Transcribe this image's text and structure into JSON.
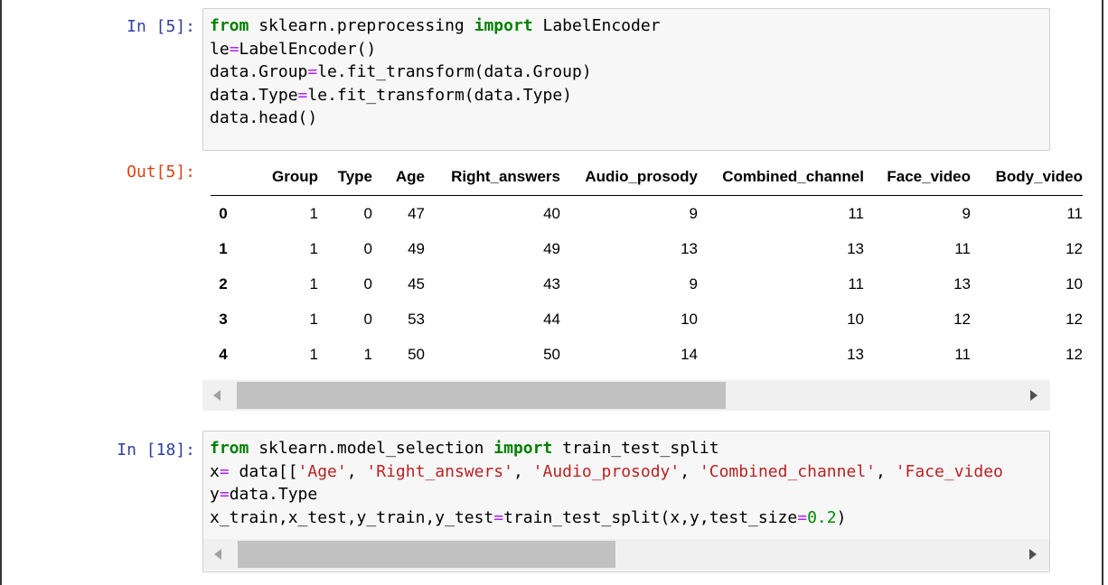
{
  "cells": {
    "cell5": {
      "in_prompt": "In [5]:",
      "out_prompt": "Out[5]:",
      "code": {
        "l1_from": "from",
        "l1_mod": " sklearn.preprocessing ",
        "l1_import": "import",
        "l1_name": " LabelEncoder",
        "l2_a": "le",
        "l2_eq": "=",
        "l2_b": "LabelEncoder()",
        "l3_a": "data.Group",
        "l3_eq": "=",
        "l3_b": "le.fit_transform(data.Group)",
        "l4_a": "data.Type",
        "l4_eq": "=",
        "l4_b": "le.fit_transform(data.Type)",
        "l5": "data.head()"
      }
    },
    "cell18": {
      "in_prompt": "In [18]:",
      "code": {
        "l1_from": "from",
        "l1_mod": " sklearn.model_selection ",
        "l1_import": "import",
        "l1_name": " train_test_split",
        "l2_a": "x",
        "l2_eq": "=",
        "l2_b": " data[[",
        "l2_s1": "'Age'",
        "l2_c1": ", ",
        "l2_s2": "'Right_answers'",
        "l2_c2": ", ",
        "l2_s3": "'Audio_prosody'",
        "l2_c3": ", ",
        "l2_s4": "'Combined_channel'",
        "l2_c4": ", ",
        "l2_s5": "'Face_video",
        "l3_a": "y",
        "l3_eq": "=",
        "l3_b": "data.Type",
        "l4_a": "x_train,x_test,y_train,y_test",
        "l4_eq": "=",
        "l4_b": "train_test_split(x,y,test_size",
        "l4_eq2": "=",
        "l4_num": "0.2",
        "l4_end": ")"
      }
    }
  },
  "dataframe": {
    "columns": [
      "Group",
      "Type",
      "Age",
      "Right_answers",
      "Audio_prosody",
      "Combined_channel",
      "Face_video",
      "Body_video"
    ],
    "rows": [
      {
        "index": "0",
        "values": [
          "1",
          "0",
          "47",
          "40",
          "9",
          "11",
          "9",
          "11"
        ]
      },
      {
        "index": "1",
        "values": [
          "1",
          "0",
          "49",
          "49",
          "13",
          "13",
          "11",
          "12"
        ]
      },
      {
        "index": "2",
        "values": [
          "1",
          "0",
          "45",
          "43",
          "9",
          "11",
          "13",
          "10"
        ]
      },
      {
        "index": "3",
        "values": [
          "1",
          "0",
          "53",
          "44",
          "10",
          "10",
          "12",
          "12"
        ]
      },
      {
        "index": "4",
        "values": [
          "1",
          "1",
          "50",
          "50",
          "14",
          "13",
          "11",
          "12"
        ]
      }
    ]
  },
  "colors": {
    "in_prompt": "#303f9f",
    "out_prompt": "#d84315",
    "keyword": "#008000",
    "operator": "#aa22ff",
    "string": "#ba2121",
    "number": "#008800"
  }
}
